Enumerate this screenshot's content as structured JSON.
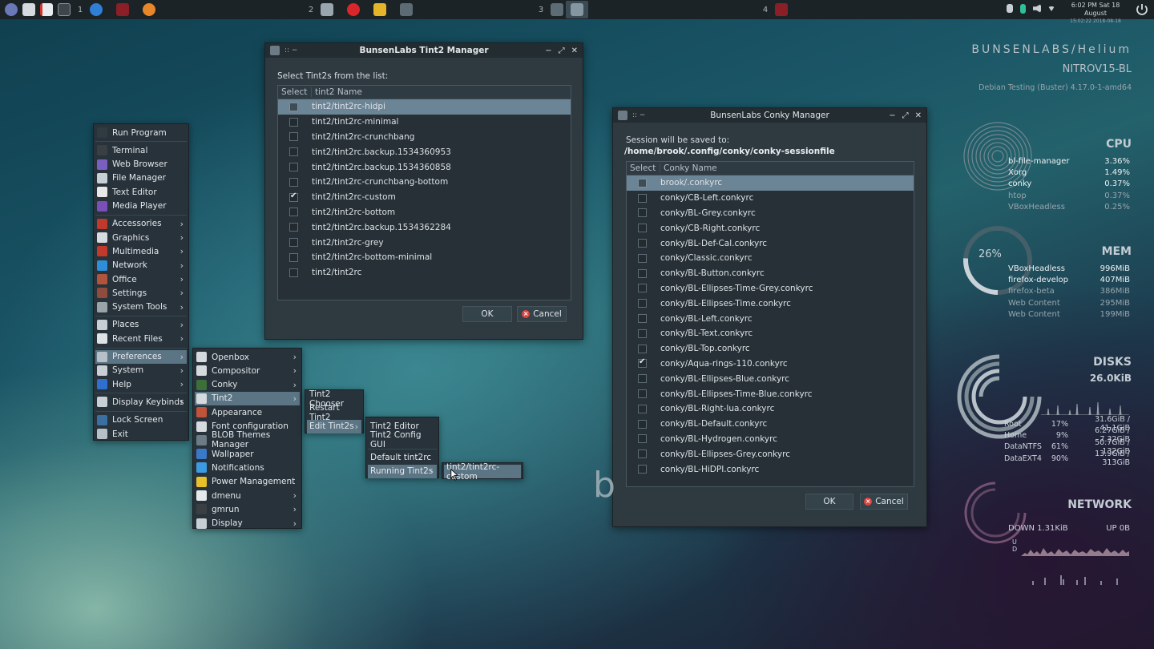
{
  "taskbar": {
    "desktops": [
      "1",
      "2",
      "3",
      "4"
    ],
    "clock_time": "6:02 PM Sat 18 August",
    "clock_sub": "15:02:22 2018-08-18"
  },
  "tint2_manager": {
    "title": "BunsenLabs Tint2 Manager",
    "prompt": "Select Tint2s from the list:",
    "col_select": "Select",
    "col_name": "tint2 Name",
    "rows": [
      {
        "name": "tint2/tint2rc-hidpi",
        "checked": false,
        "selected": true
      },
      {
        "name": "tint2/tint2rc-minimal",
        "checked": false
      },
      {
        "name": "tint2/tint2rc-crunchbang",
        "checked": false
      },
      {
        "name": "tint2/tint2rc.backup.1534360953",
        "checked": false
      },
      {
        "name": "tint2/tint2rc.backup.1534360858",
        "checked": false
      },
      {
        "name": "tint2/tint2rc-crunchbang-bottom",
        "checked": false
      },
      {
        "name": "tint2/tint2rc-custom",
        "checked": true
      },
      {
        "name": "tint2/tint2rc-bottom",
        "checked": false
      },
      {
        "name": "tint2/tint2rc.backup.1534362284",
        "checked": false
      },
      {
        "name": "tint2/tint2rc-grey",
        "checked": false
      },
      {
        "name": "tint2/tint2rc-bottom-minimal",
        "checked": false
      },
      {
        "name": "tint2/tint2rc",
        "checked": false
      }
    ],
    "ok": "OK",
    "cancel": "Cancel"
  },
  "conky_manager": {
    "title": "BunsenLabs Conky Manager",
    "session_label": "Session will be saved to:",
    "session_path": " /home/brook/.config/conky/conky-sessionfile",
    "col_select": "Select",
    "col_name": "Conky Name",
    "rows": [
      {
        "name": "brook/.conkyrc",
        "checked": false,
        "selected": true
      },
      {
        "name": "conky/CB-Left.conkyrc",
        "checked": false
      },
      {
        "name": "conky/BL-Grey.conkyrc",
        "checked": false
      },
      {
        "name": "conky/CB-Right.conkyrc",
        "checked": false
      },
      {
        "name": "conky/BL-Def-Cal.conkyrc",
        "checked": false
      },
      {
        "name": "conky/Classic.conkyrc",
        "checked": false
      },
      {
        "name": "conky/BL-Button.conkyrc",
        "checked": false
      },
      {
        "name": "conky/BL-Ellipses-Time-Grey.conkyrc",
        "checked": false
      },
      {
        "name": "conky/BL-Ellipses-Time.conkyrc",
        "checked": false
      },
      {
        "name": "conky/BL-Left.conkyrc",
        "checked": false
      },
      {
        "name": "conky/BL-Text.conkyrc",
        "checked": false
      },
      {
        "name": "conky/BL-Top.conkyrc",
        "checked": false
      },
      {
        "name": "conky/Aqua-rings-110.conkyrc",
        "checked": true
      },
      {
        "name": "conky/BL-Ellipses-Blue.conkyrc",
        "checked": false
      },
      {
        "name": "conky/BL-Ellipses-Time-Blue.conkyrc",
        "checked": false
      },
      {
        "name": "conky/BL-Right-lua.conkyrc",
        "checked": false
      },
      {
        "name": "conky/BL-Default.conkyrc",
        "checked": false
      },
      {
        "name": "conky/BL-Hydrogen.conkyrc",
        "checked": false
      },
      {
        "name": "conky/BL-Ellipses-Grey.conkyrc",
        "checked": false
      },
      {
        "name": "conky/BL-HiDPI.conkyrc",
        "checked": false
      }
    ],
    "ok": "OK",
    "cancel": "Cancel"
  },
  "root_menu": {
    "items": [
      {
        "label": "Run Program",
        "icon": "#2f3a41"
      },
      {
        "label": "Terminal",
        "icon": "#3a3f44"
      },
      {
        "label": "Web Browser",
        "icon": "#7a5fc0"
      },
      {
        "label": "File Manager",
        "icon": "#c9d0d5"
      },
      {
        "label": "Text Editor",
        "icon": "#e8e8e8"
      },
      {
        "label": "Media Player",
        "icon": "#7a4fb8"
      },
      {
        "label": "Accessories",
        "icon": "#c0392b",
        "sub": true
      },
      {
        "label": "Graphics",
        "icon": "#d6dbdf",
        "sub": true
      },
      {
        "label": "Multimedia",
        "icon": "#c0392b",
        "sub": true
      },
      {
        "label": "Network",
        "icon": "#2f8ed8",
        "sub": true
      },
      {
        "label": "Office",
        "icon": "#b0553b",
        "sub": true
      },
      {
        "label": "Settings",
        "icon": "#8f4b3c",
        "sub": true
      },
      {
        "label": "System Tools",
        "icon": "#9aa3a8",
        "sub": true
      },
      {
        "label": "Places",
        "icon": "#c9d0d5",
        "sub": true
      },
      {
        "label": "Recent Files",
        "icon": "#dfe3e6",
        "sub": true
      },
      {
        "label": "Preferences",
        "icon": "#b7c0c6",
        "sub": true,
        "hl": true
      },
      {
        "label": "System",
        "icon": "#c9d0d5",
        "sub": true
      },
      {
        "label": "Help",
        "icon": "#2f6fd0",
        "sub": true
      },
      {
        "label": "Display Keybinds",
        "icon": "#c9d0d5",
        "sub": true
      },
      {
        "label": "Lock Screen",
        "icon": "#3b6fa0"
      },
      {
        "label": "Exit",
        "icon": "#b7c0c6"
      }
    ]
  },
  "pref_menu": {
    "items": [
      {
        "label": "Openbox",
        "icon": "#d5dade",
        "sub": true
      },
      {
        "label": "Compositor",
        "icon": "#d5dade",
        "sub": true
      },
      {
        "label": "Conky",
        "icon": "#3d6f3a",
        "sub": true
      },
      {
        "label": "Tint2",
        "icon": "#d5dade",
        "sub": true,
        "hl": true
      },
      {
        "label": "Appearance",
        "icon": "#c0533b"
      },
      {
        "label": "Font configuration",
        "icon": "#d5dade"
      },
      {
        "label": "BLOB Themes Manager",
        "icon": "#6c7b86"
      },
      {
        "label": "Wallpaper",
        "icon": "#3b78c8"
      },
      {
        "label": "Notifications",
        "icon": "#3b9ae0"
      },
      {
        "label": "Power Management",
        "icon": "#e8c02a"
      },
      {
        "label": "dmenu",
        "icon": "#e5e9ec",
        "sub": true
      },
      {
        "label": "gmrun",
        "icon": "#3a3f44",
        "sub": true
      },
      {
        "label": "Display",
        "icon": "#c9d0d5",
        "sub": true
      }
    ]
  },
  "tint2_menu": {
    "items": [
      {
        "label": "Tint2 Chooser"
      },
      {
        "label": "Restart Tint2"
      },
      {
        "label": "Edit Tint2s",
        "sub": true,
        "hl": true
      }
    ]
  },
  "edit_menu": {
    "items": [
      {
        "label": "Tint2 Editor"
      },
      {
        "label": "Tint2 Config GUI"
      },
      {
        "label": "Default tint2rc"
      },
      {
        "label": "Running Tint2s",
        "sub": true,
        "hl": true
      }
    ]
  },
  "running_menu": {
    "items": [
      {
        "label": "tint2/tint2rc-custom",
        "hl": true
      }
    ]
  },
  "conky": {
    "brand": "BUNSENLABS/Helium",
    "host": "NITROV15-BL",
    "os": "Debian Testing (Buster) 4.17.0-1-amd64",
    "cpu": {
      "title": "CPU",
      "procs": [
        {
          "name": "bl-file-manager",
          "val": "3.36%"
        },
        {
          "name": "Xorg",
          "val": "1.49%"
        },
        {
          "name": "conky",
          "val": "0.37%"
        },
        {
          "name": "htop",
          "val": "0.37%"
        },
        {
          "name": "VBoxHeadless",
          "val": "0.25%"
        }
      ]
    },
    "mem": {
      "title": "MEM",
      "percent": "26%",
      "percent_value": 0.26,
      "procs": [
        {
          "name": "VBoxHeadless",
          "val": "996MiB"
        },
        {
          "name": "firefox-develop",
          "val": "407MiB"
        },
        {
          "name": "firefox-beta",
          "val": "386MiB"
        },
        {
          "name": "Web Content",
          "val": "295MiB"
        },
        {
          "name": "Web Content",
          "val": "199MiB"
        }
      ]
    },
    "disks": {
      "title": "DISKS",
      "io": "26.0KiB",
      "rows": [
        {
          "name": "Root",
          "pct": "17%",
          "used": "31.6GiB / 41.1GiB"
        },
        {
          "name": "Home",
          "pct": "9%",
          "used": "6.27GiB / 7.32GiB"
        },
        {
          "name": "DataNTFS",
          "pct": "61%",
          "used": "50.7GiB / 132GiB"
        },
        {
          "name": "DataEXT4",
          "pct": "90%",
          "used": "13.9GiB / 313GiB"
        }
      ]
    },
    "network": {
      "title": "NETWORK",
      "down": "DOWN 1.31KiB",
      "up": "UP 0B",
      "u_label": "U",
      "d_label": "D"
    }
  },
  "desktop_letter": "b"
}
